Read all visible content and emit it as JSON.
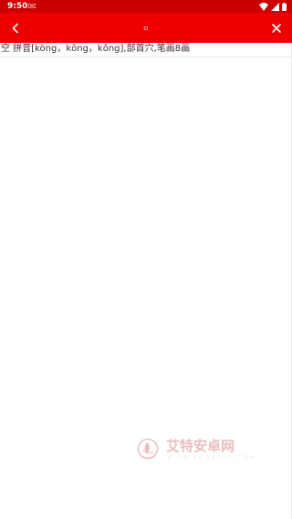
{
  "status_bar": {
    "time": "9:50",
    "icons": [
      "notification-icon",
      "wifi-icon",
      "signal-icon",
      "battery-icon"
    ]
  },
  "app_bar": {
    "title": "▫",
    "back_icon": "chevron-left-icon",
    "close_icon": "close-icon"
  },
  "content": {
    "definition": "空 拼音[kòng，kōng，kǒng],部首穴,笔画8画"
  },
  "watermark": {
    "name": "艾特安卓网",
    "sub": "AITE·ANDROID·COM"
  },
  "colors": {
    "status_bar": "#cc0000",
    "app_bar": "#ee0000",
    "text": "#333333",
    "background": "#ffffff"
  }
}
